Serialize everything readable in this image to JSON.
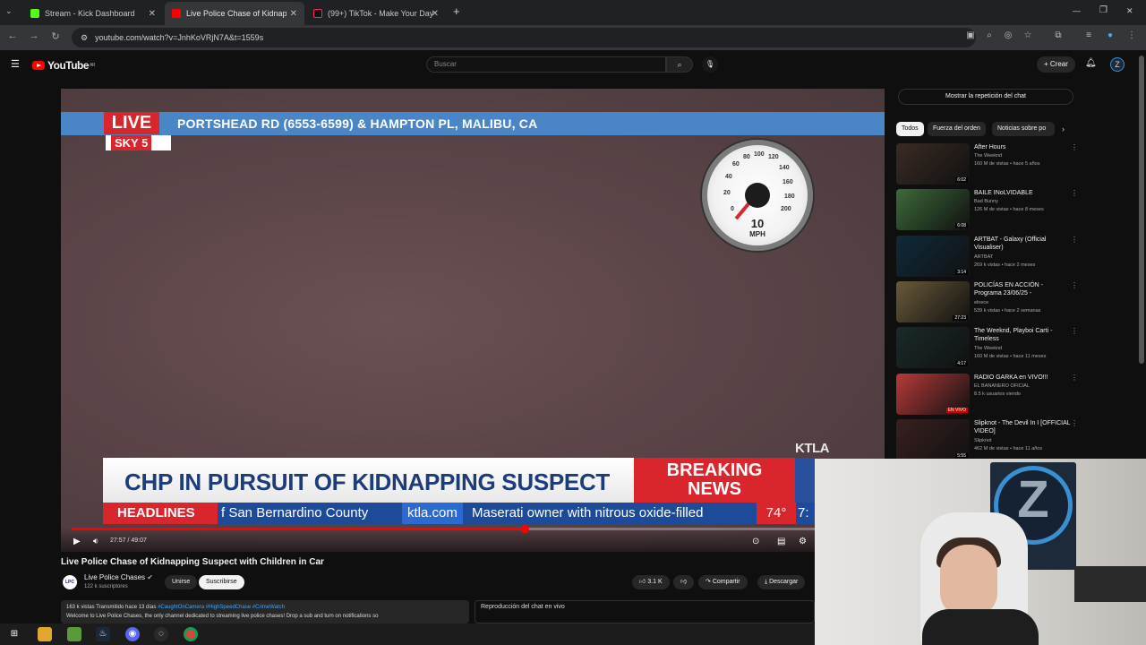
{
  "browser": {
    "tabs": [
      {
        "label": "Stream - Kick Dashboard",
        "favicon_color": "#53fc18",
        "active": false
      },
      {
        "label": "Live Police Chase of Kidnapping",
        "favicon_color": "#ff0000",
        "active": true
      },
      {
        "label": "(99+) TikTok - Make Your Day",
        "favicon_color": "#111111",
        "active": false
      }
    ],
    "new_tab": "+",
    "url": "youtube.com/watch?v=JnhKoVRjN7A&t=1559s",
    "window_controls": [
      "—",
      "❐",
      "✕"
    ]
  },
  "youtube": {
    "logo_text": "YouTube",
    "logo_region": "AR",
    "search_placeholder": "Buscar",
    "create_label": "+ Crear"
  },
  "video": {
    "overlay": {
      "live": "LIVE",
      "sky": "SKY 5",
      "location": "PORTSHEAD RD (6553-6599) & HAMPTON PL, MALIBU, CA",
      "speed_value": "10",
      "speed_unit": "MPH",
      "speed_ticks": [
        "20",
        "40",
        "60",
        "80",
        "100",
        "120",
        "140",
        "160",
        "180",
        "200",
        "0"
      ],
      "station_bug": "KTLA",
      "headline": "CHP IN PURSUIT OF KIDNAPPING SUSPECT",
      "breaking_line1": "BREAKING",
      "breaking_line2": "NEWS",
      "ticker_label": "HEADLINES",
      "ticker_text1": "f San Bernardino County",
      "ticker_site": "ktla.com",
      "ticker_text2": "Maserati owner with nitrous oxide-filled",
      "temperature": "74°",
      "clock": "7:"
    },
    "time": "27:57 / 49:07",
    "progress_fraction": 0.565
  },
  "watch": {
    "title": "Live Police Chase of Kidnapping Suspect with Children in Car",
    "channel_avatar": "LPC",
    "channel_name": "Live Police Chases",
    "subscribers": "122 k suscriptores",
    "join_label": "Unirse",
    "subscribe_label": "Suscribirse",
    "likes": "3.1 K",
    "share_label": "Compartir",
    "download_label": "Descargar",
    "desc_stats": "163 k vistas  Transmitido hace 13 días",
    "desc_tags": "#CaughtOnCamera #HighSpeedChase #CrimeWatch",
    "desc_text": "Welcome to Live Police Chases, the only channel dedicated to streaming live police chases! Drop a sub and turn on notifications so",
    "chat_replay_title": "Reproducción del chat en vivo"
  },
  "sidebar": {
    "chat_button": "Mostrar la repetición del chat",
    "chips": [
      "Todos",
      "Fuerza del orden",
      "Noticias sobre po"
    ],
    "recommendations": [
      {
        "title": "After Hours",
        "channel": "The Weeknd",
        "meta": "160 M de vistas • hace 5 años",
        "duration": "6:02",
        "thumb": "#3a2b24"
      },
      {
        "title": "BAILE INoLVIDABLE",
        "channel": "Bad Bunny",
        "meta": "126 M de vistas • hace 8 meses",
        "duration": "6:08",
        "thumb": "#3d6a3a"
      },
      {
        "title": "ARTBAT - Galaxy (Official Visualiser)",
        "channel": "ARTBAT",
        "meta": "269 k vistas • hace 2 meses",
        "duration": "3:14",
        "thumb": "#0f2a3a"
      },
      {
        "title": "POLICÍAS EN ACCIÓN - Programa 23/06/25 -",
        "channel": "elnece",
        "meta": "539 k vistas • hace 2 semanas",
        "duration": "27:23",
        "thumb": "#6a5a3a"
      },
      {
        "title": "The Weeknd, Playboi Carti - Timeless",
        "channel": "The Weeknd",
        "meta": "160 M de vistas • hace 11 meses",
        "duration": "4:17",
        "thumb": "#1a2a2a"
      },
      {
        "title": "RADIO GARKA en VIVO!!!",
        "channel": "EL BANANERO OFICIAL",
        "meta": "8.5 k usuarios viendo",
        "duration": "EN VIVO",
        "thumb": "#b83a3a"
      },
      {
        "title": "Slipknot - The Devil In I [OFFICIAL VIDEO]",
        "channel": "Slipknot",
        "meta": "462 M de vistas • hace 11 años",
        "duration": "5:55",
        "thumb": "#3a2020"
      }
    ]
  },
  "webcam": {
    "logo_letter": "Z"
  },
  "taskbar": {
    "icons": [
      "windows-icon",
      "file-explorer-icon",
      "app-icon",
      "steam-icon",
      "discord-icon",
      "obs-icon",
      "chrome-icon"
    ]
  }
}
